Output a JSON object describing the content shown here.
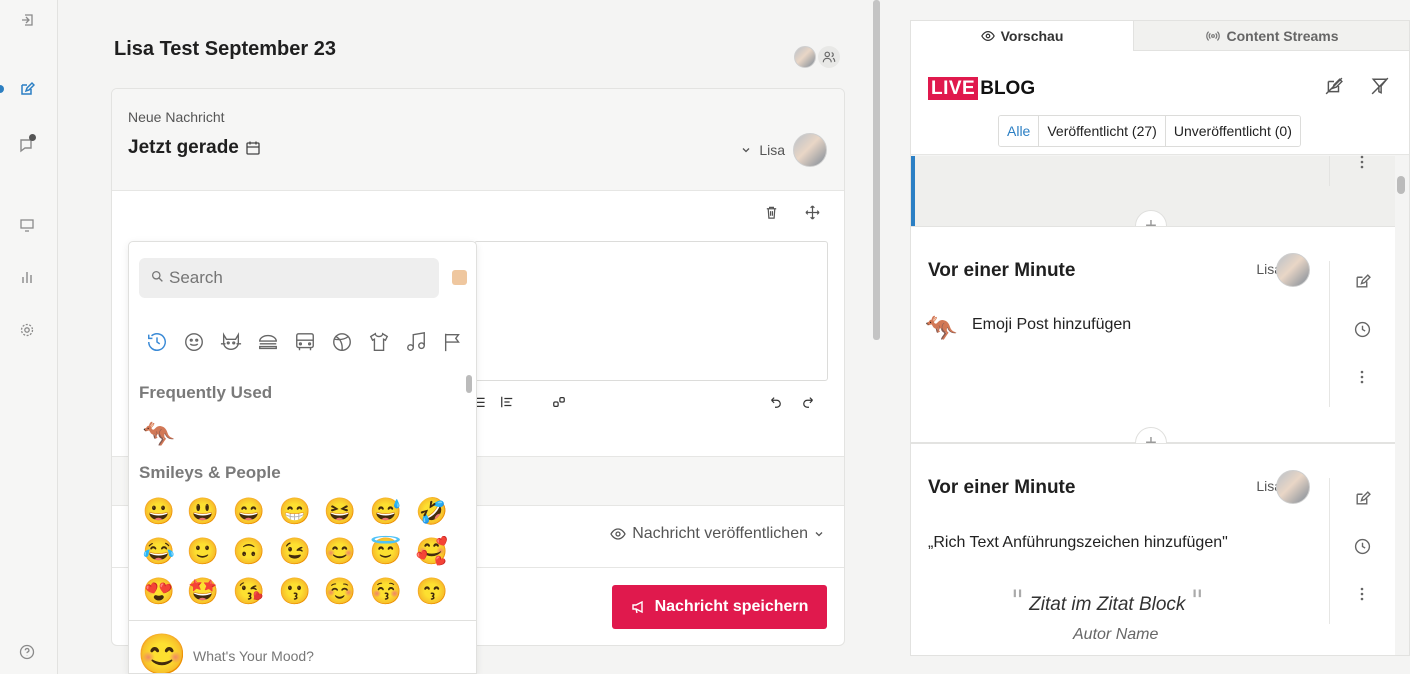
{
  "editor": {
    "title": "Lisa Test September 23",
    "card_label": "Neue Nachricht",
    "time_label": "Jetzt gerade",
    "author": "Lisa",
    "publish_label": "Nachricht veröffentlichen",
    "save_label": "Nachricht speichern"
  },
  "emoji_picker": {
    "search_placeholder": "Search",
    "categories": [
      "recent",
      "smileys",
      "animals",
      "food",
      "travel",
      "activities",
      "objects",
      "symbols",
      "flags"
    ],
    "frequently_used_title": "Frequently Used",
    "frequently_used": [
      "🦘"
    ],
    "smileys_title": "Smileys & People",
    "smileys_row1": [
      "😀",
      "😃",
      "😄",
      "😁",
      "😆",
      "😅",
      "🤣"
    ],
    "smileys_row2": [
      "😂",
      "🙂",
      "🙃",
      "😉",
      "😊",
      "😇",
      "🥰"
    ],
    "smileys_row3": [
      "😍",
      "🤩",
      "😘",
      "😗",
      "☺️",
      "😚",
      "😙"
    ],
    "mood_emoji": "😊",
    "mood_placeholder": "What's Your Mood?"
  },
  "preview": {
    "tab_preview": "Vorschau",
    "tab_streams": "Content Streams",
    "logo_live": "LIVE",
    "logo_blog": "BLOG",
    "filters": {
      "all": "Alle",
      "published": "Veröffentlicht (27)",
      "unpublished": "Unveröffentlicht (0)"
    },
    "posts": [
      {
        "time": "Vor einer Minute",
        "author": "Lisa",
        "emoji": "🦘",
        "text": "Emoji Post hinzufügen"
      },
      {
        "time": "Vor einer Minute",
        "author": "Lisa",
        "text": "„Rich Text Anführungszeichen hinzufügen\"",
        "quote": "Zitat im Zitat Block",
        "quote_author": "Autor Name"
      }
    ]
  },
  "colors": {
    "accent_red": "#e0194d",
    "accent_blue": "#2b7fc4"
  }
}
